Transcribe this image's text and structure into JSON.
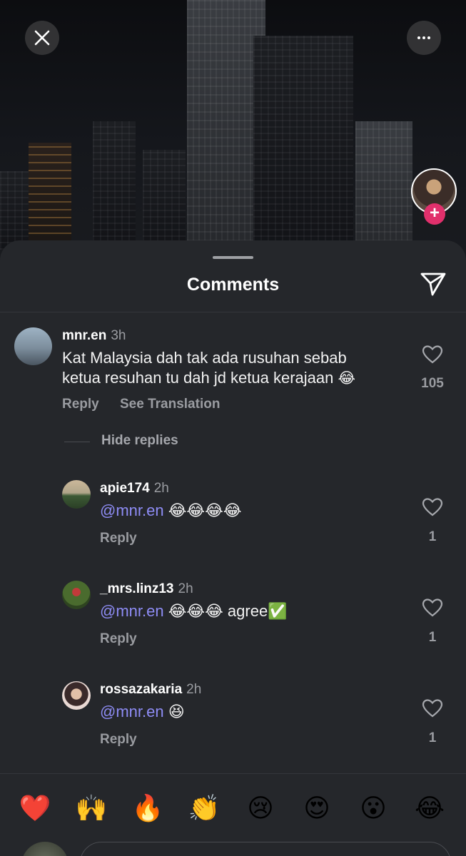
{
  "sheet": {
    "title": "Comments"
  },
  "comments": [
    {
      "username": "mnr.en",
      "time": "3h",
      "text_line1": "Kat Malaysia dah tak ada rusuhan sebab",
      "text_line2": "ketua resuhan tu dah jd ketua kerajaan",
      "emoji": "😂",
      "likes": "105",
      "reply_label": "Reply",
      "translate_label": "See Translation"
    }
  ],
  "hide_replies_label": "Hide replies",
  "replies": [
    {
      "username": "apie174",
      "time": "2h",
      "mention": "@mnr.en",
      "text": " 😂😂😂😂",
      "likes": "1",
      "reply_label": "Reply"
    },
    {
      "username": "_mrs.linz13",
      "time": "2h",
      "mention": "@mnr.en",
      "text": " 😂😂😂 agree✅",
      "likes": "1",
      "reply_label": "Reply"
    },
    {
      "username": "rossazakaria",
      "time": "2h",
      "mention": "@mnr.en",
      "text": " 😆",
      "likes": "1",
      "reply_label": "Reply"
    }
  ],
  "reactions": [
    "❤️",
    "🙌",
    "🔥",
    "👏",
    "😢",
    "😍",
    "😮",
    "😂"
  ],
  "colors": {
    "sheet_bg": "#25272b",
    "mention": "#8e8cf5",
    "muted": "#9a9ca1",
    "follow_plus": "#e1306c"
  },
  "icons": [
    "close-icon",
    "more-icon",
    "send-icon",
    "heart-icon",
    "plus-icon"
  ]
}
